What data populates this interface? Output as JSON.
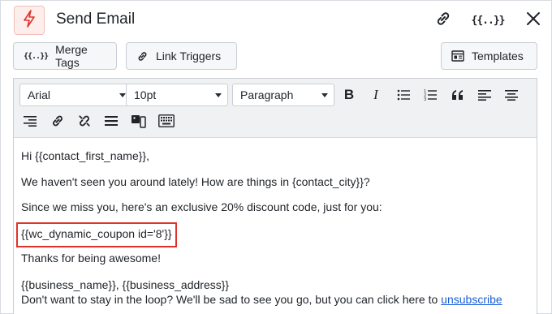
{
  "header": {
    "title": "Send Email",
    "merge_icon_text": "{{..}}"
  },
  "actions": {
    "merge_tags_label": "Merge Tags",
    "merge_tags_icon_text": "{{..}}",
    "link_triggers_label": "Link Triggers",
    "templates_label": "Templates"
  },
  "toolbar": {
    "font_family": "Arial",
    "font_size": "10pt",
    "block_format": "Paragraph"
  },
  "body": {
    "greeting": "Hi {{contact_first_name}},",
    "line1": "We haven't seen you around lately! How are things in {contact_city}}?",
    "line2": "Since we miss you, here's an exclusive 20% discount code, just for you:",
    "coupon": "{{wc_dynamic_coupon id='8'}}",
    "thanks": "Thanks for being awesome!",
    "business": "{{business_name}}, {{business_address}}",
    "footer_text": "Don't want to stay in the loop? We'll be sad to see you go, but you can click here to",
    "unsubscribe_label": "unsubscribe"
  },
  "colors": {
    "accent_red": "#e0322b",
    "link_blue": "#1a5ed6"
  }
}
